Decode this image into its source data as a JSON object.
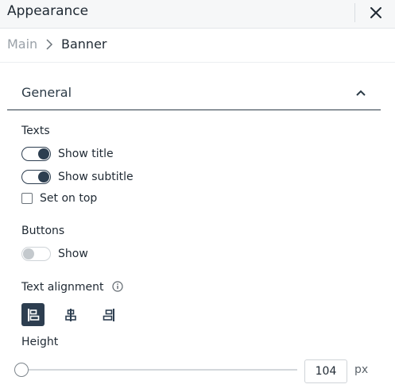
{
  "header": {
    "title": "Appearance",
    "close_icon": "close-icon"
  },
  "breadcrumb": {
    "root": "Main",
    "current": "Banner"
  },
  "section": {
    "title": "General",
    "expanded": true
  },
  "texts": {
    "label": "Texts",
    "show_title": {
      "label": "Show title",
      "on": true
    },
    "show_subtitle": {
      "label": "Show subtitle",
      "on": true
    },
    "set_on_top": {
      "label": "Set on top",
      "checked": false
    }
  },
  "buttons": {
    "label": "Buttons",
    "show": {
      "label": "Show",
      "on": false
    }
  },
  "alignment": {
    "label": "Text alignment",
    "options": [
      "left",
      "center",
      "right"
    ],
    "selected": "left"
  },
  "height": {
    "label": "Height",
    "value": "104",
    "unit": "px"
  },
  "colors": {
    "accent": "#2d3e50",
    "muted": "#9aa1a8",
    "border": "#cfd4d8"
  }
}
